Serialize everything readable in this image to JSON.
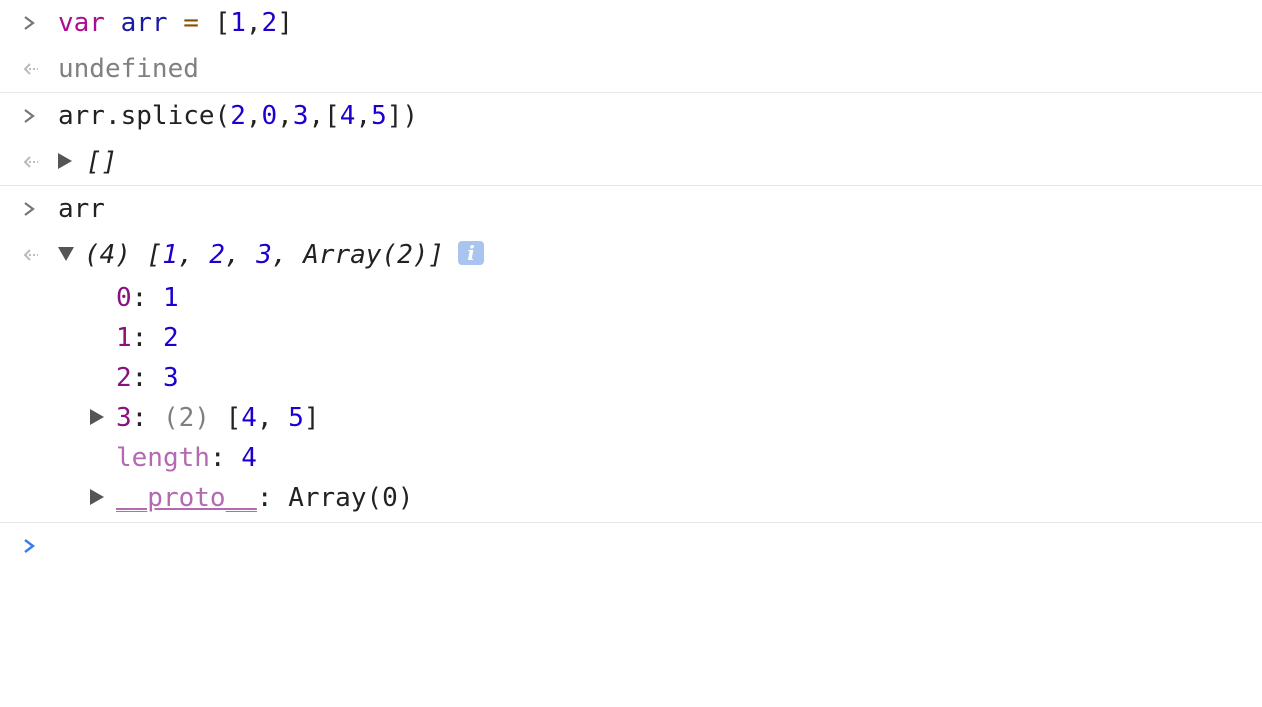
{
  "console": {
    "entries": [
      {
        "type": "input",
        "keyword": "var",
        "name": "arr",
        "op": "=",
        "open": "[",
        "v1": "1",
        "comma": ",",
        "v2": "2",
        "close": "]"
      },
      {
        "type": "output",
        "text": "undefined"
      },
      {
        "type": "input",
        "prefix": "arr.splice(",
        "a1": "2",
        "c1": ",",
        "a2": "0",
        "c2": ",",
        "a3": "3",
        "c3": ",",
        "open": "[",
        "a4": "4",
        "c4": ",",
        "a5": "5",
        "close": "])"
      },
      {
        "type": "output",
        "text": "[]"
      },
      {
        "type": "input",
        "text": "arr"
      },
      {
        "type": "output",
        "summary_prefix": "(4) [",
        "s1": "1",
        "s2": "2",
        "s3": "3",
        "s4": "Array(2)",
        "summary_close": "]",
        "sep": ", ",
        "info_icon": "i",
        "children": [
          {
            "key": "0",
            "value": "1"
          },
          {
            "key": "1",
            "value": "2"
          },
          {
            "key": "2",
            "value": "3"
          },
          {
            "key": "3",
            "count": "(2)",
            "open": "[",
            "v1": "4",
            "sep": ", ",
            "v2": "5",
            "close": "]"
          },
          {
            "key": "length",
            "value": "4"
          },
          {
            "key": "__proto__",
            "value": "Array(0)"
          }
        ]
      }
    ]
  },
  "colors": {
    "keyword": "#aa0d91",
    "number": "#1c00cf",
    "key": "#881280",
    "key_light": "#b36ab3",
    "gray": "#808080",
    "prompt_active": "#367cf1",
    "info_icon_bg": "#a8c4ef"
  },
  "icons": {
    "input_prompt": "chevron-right-icon",
    "output_prompt": "return-arrow-icon",
    "collapsed": "triangle-right-icon",
    "expanded": "triangle-down-icon",
    "info": "info-icon"
  }
}
